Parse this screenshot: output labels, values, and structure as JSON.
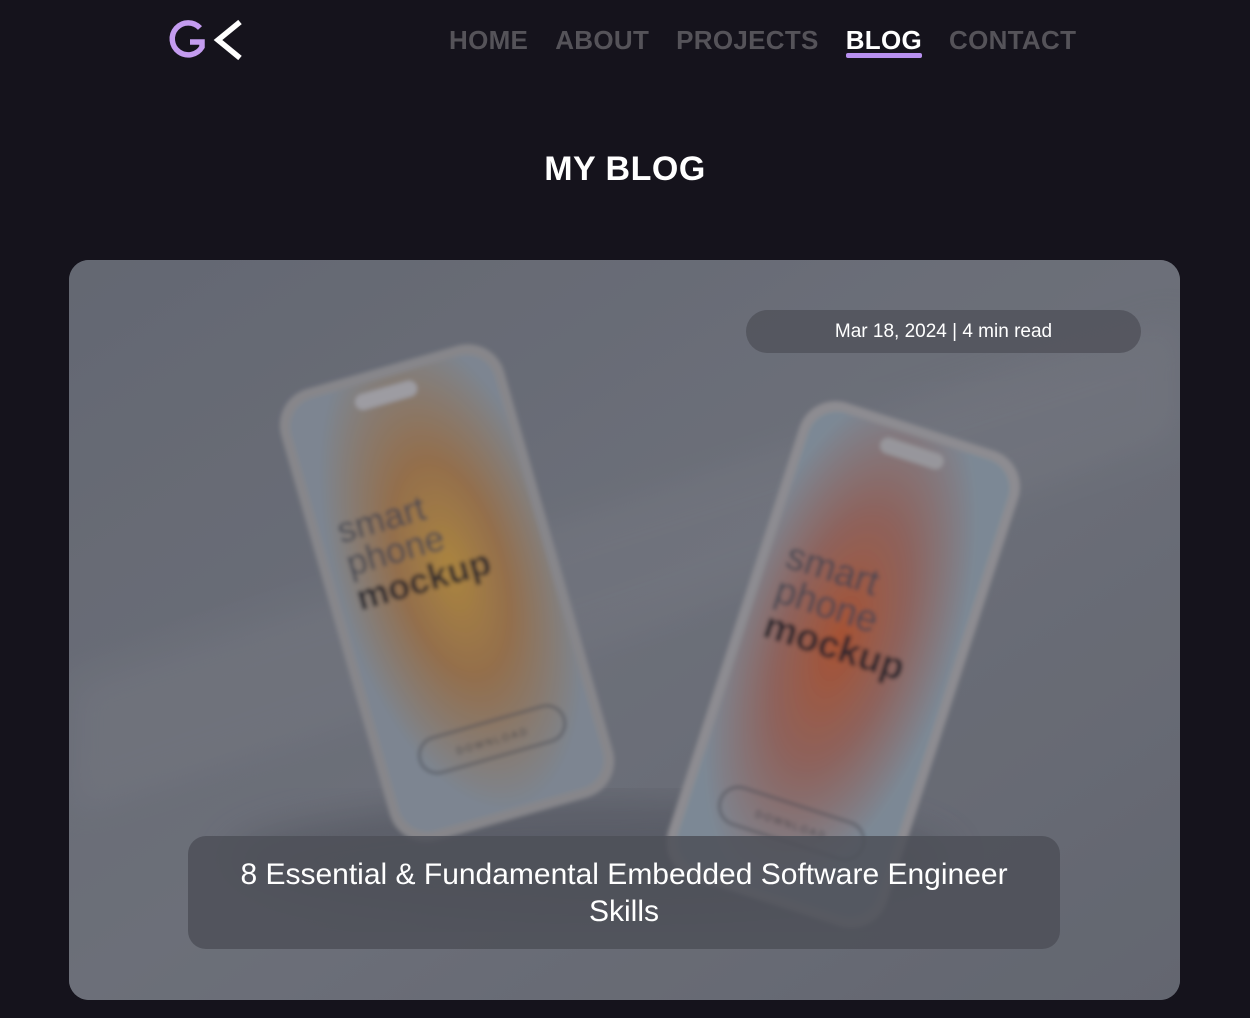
{
  "header": {
    "logo_text": "GK",
    "nav": [
      {
        "label": "HOME",
        "active": false
      },
      {
        "label": "ABOUT",
        "active": false
      },
      {
        "label": "PROJECTS",
        "active": false
      },
      {
        "label": "BLOG",
        "active": true
      },
      {
        "label": "CONTACT",
        "active": false
      }
    ]
  },
  "page": {
    "title": "MY BLOG"
  },
  "posts": [
    {
      "meta": "Mar 18, 2024 | 4 min read",
      "title": "8 Essential & Fundamental Embedded Software Engineer Skills",
      "image_text": {
        "line1": "smart",
        "line2": "phone",
        "line3": "mockup",
        "button": "DOWNLOAD"
      }
    }
  ],
  "colors": {
    "background": "#15131c",
    "accent": "#b890f0",
    "nav_inactive": "#555359",
    "text": "#ffffff"
  }
}
